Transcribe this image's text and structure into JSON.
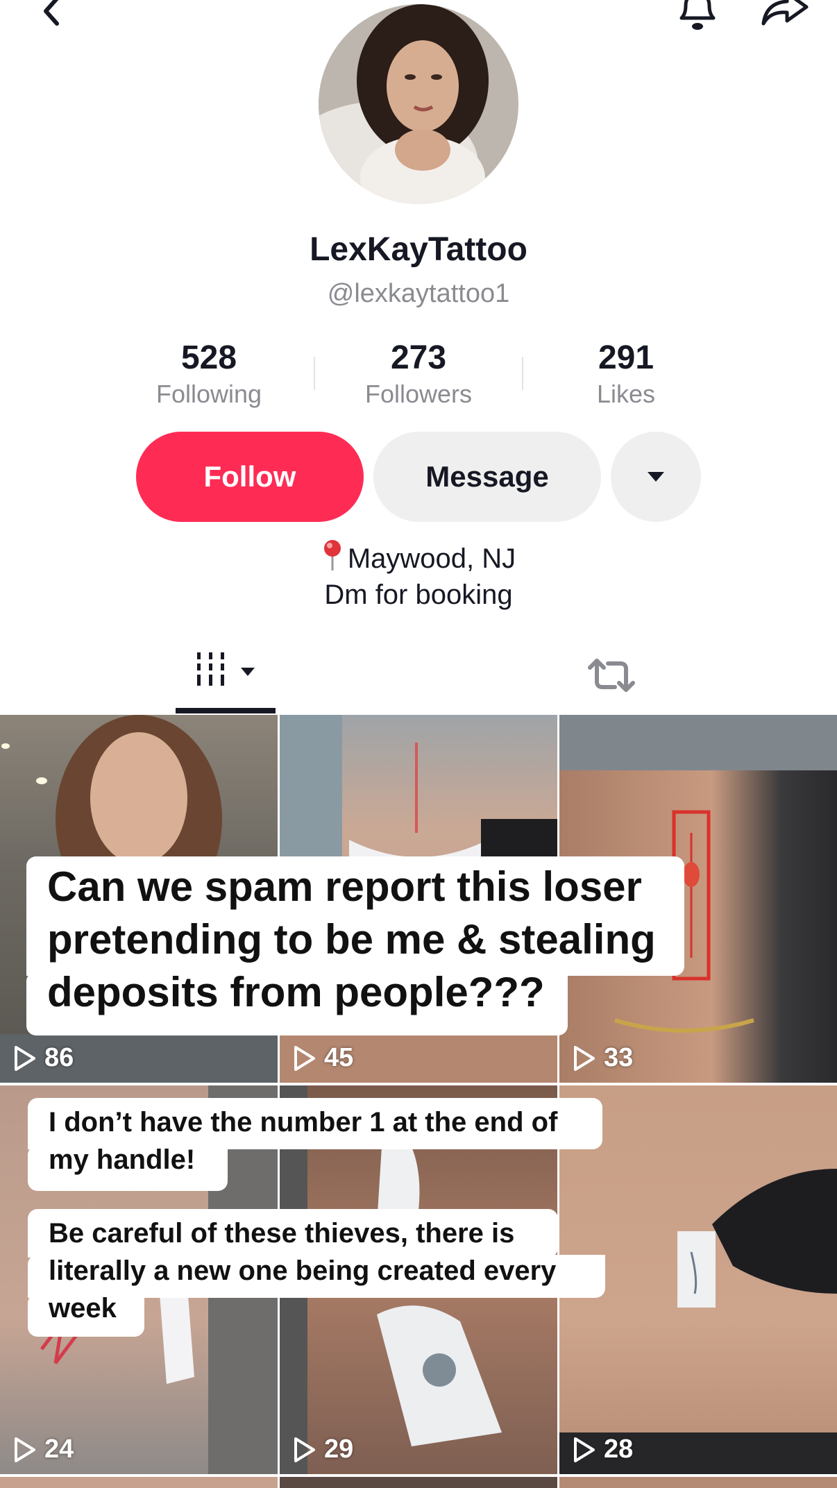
{
  "profile": {
    "display_name": "LexKayTattoo",
    "handle": "@lexkaytattoo1"
  },
  "stats": [
    {
      "value": "528",
      "label": "Following"
    },
    {
      "value": "273",
      "label": "Followers"
    },
    {
      "value": "291",
      "label": "Likes"
    }
  ],
  "actions": {
    "follow_label": "Follow",
    "message_label": "Message"
  },
  "bio": {
    "location": "Maywood, NJ",
    "line2": "Dm for booking"
  },
  "grid": {
    "views": [
      "86",
      "45",
      "33",
      "24",
      "29",
      "28"
    ]
  },
  "overlay": {
    "caption1_line1": "Can we spam report this loser",
    "caption1_line2": "pretending to be me & stealing",
    "caption1_line3": "deposits from people???",
    "caption2_line1": "I don’t have the number 1 at the end of",
    "caption2_line2": "my handle!",
    "caption3_line1": "Be careful of these thieves, there is",
    "caption3_line2": "literally a new one being created every",
    "caption3_line3": "week"
  },
  "colors": {
    "accent": "#fe2c55",
    "secondary_button": "#efefef",
    "muted_text": "#8a8b91"
  },
  "icons": [
    "back-icon",
    "bell-icon",
    "share-icon",
    "caret-down-icon",
    "pin-icon",
    "videos-grid-icon",
    "repost-icon",
    "play-icon"
  ]
}
